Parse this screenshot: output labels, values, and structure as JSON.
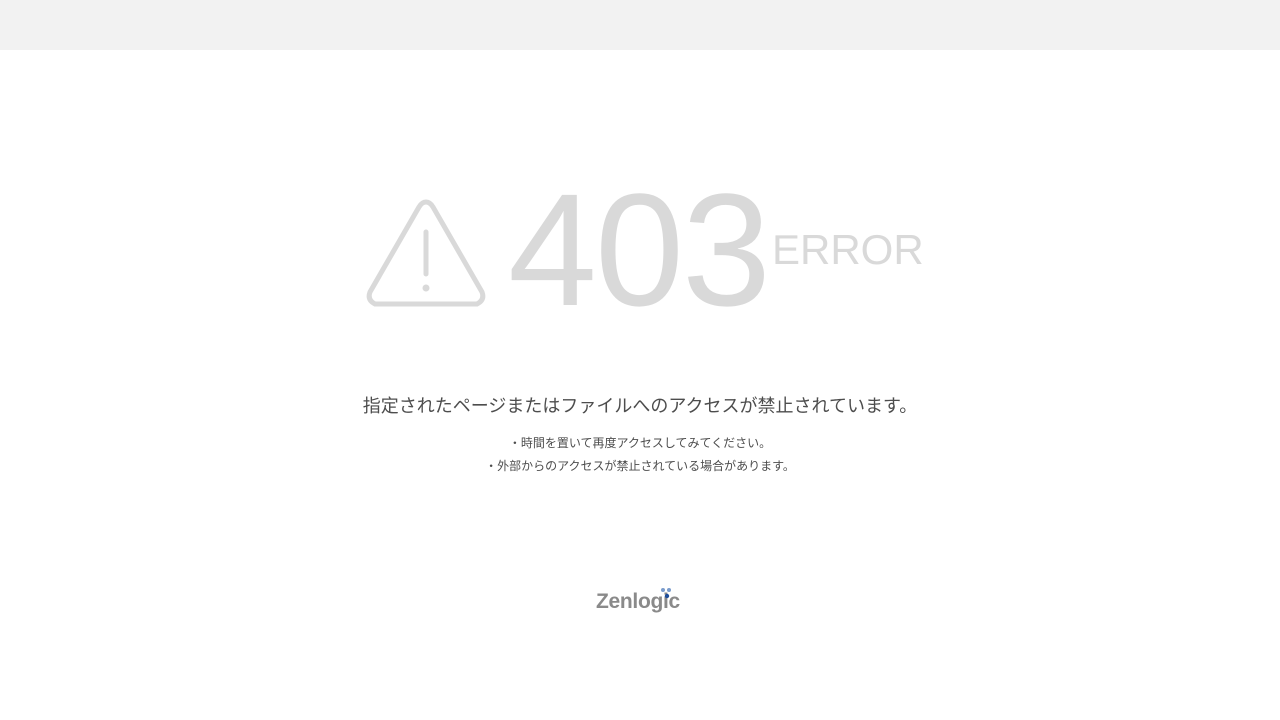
{
  "error": {
    "code": "403",
    "label": "ERROR"
  },
  "message": "指定されたページまたはファイルへのアクセスが禁止されています。",
  "hints": [
    "・時間を置いて再度アクセスしてみてください。",
    "・外部からのアクセスが禁止されている場合があります。"
  ],
  "brand": {
    "name": "Zenlogic",
    "dot_colors": [
      "#7a9ccc",
      "#1f4e9a"
    ]
  },
  "icons": {
    "warning": "warning-triangle-icon"
  },
  "colors": {
    "topbar": "#f2f2f2",
    "error_text": "#d9d9d9",
    "body_text": "#4d4d4d"
  }
}
